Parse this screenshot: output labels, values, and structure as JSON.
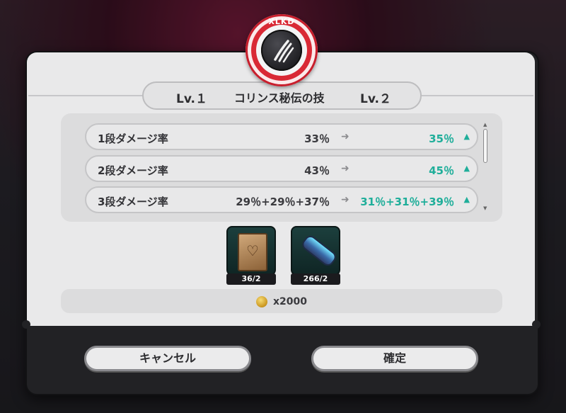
{
  "emblem": {
    "label": "XLKD",
    "icon": "claw-scratch-icon"
  },
  "header": {
    "level_from": "Lv.１",
    "skill_name": "コリンス秘伝の技",
    "level_to": "Lv.２"
  },
  "stats": [
    {
      "label": "1段ダメージ率",
      "old": "33％",
      "new": "35％"
    },
    {
      "label": "2段ダメージ率",
      "old": "43％",
      "new": "45％"
    },
    {
      "label": "3段ダメージ率",
      "old": "29％+29％+37％",
      "new": "31％+31％+39％"
    }
  ],
  "materials": [
    {
      "icon": "heart-card-icon",
      "count": "36/2"
    },
    {
      "icon": "energy-tube-icon",
      "count": "266/2"
    }
  ],
  "cost": {
    "icon": "gold-coin-icon",
    "text": "x2000"
  },
  "buttons": {
    "cancel": "キャンセル",
    "confirm": "確定"
  },
  "colors": {
    "increase": "#1fae9a",
    "emblem_red": "#d92935"
  }
}
